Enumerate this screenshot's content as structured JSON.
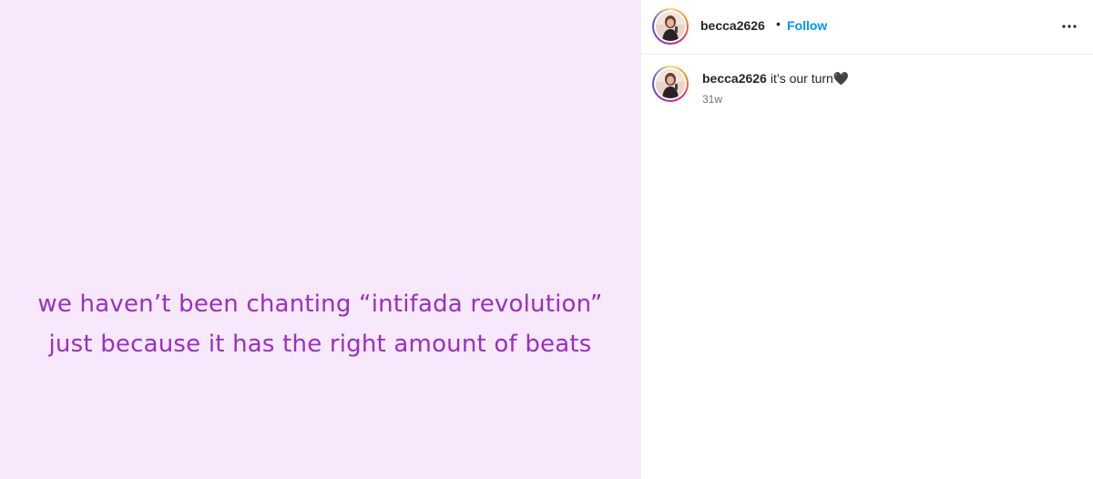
{
  "post": {
    "media_text_lines": [
      "we haven’t been chanting “intifada revolution”",
      "just because it has the right amount of beats"
    ],
    "media_background": "#f7e8fb",
    "media_text_color": "#9a2fc0"
  },
  "header": {
    "username": "becca2626",
    "separator": "•",
    "follow_label": "Follow",
    "more_icon": "more-horizontal-icon"
  },
  "caption": {
    "username": "becca2626",
    "text": "it’s our turn🖤",
    "timestamp": "31w"
  },
  "colors": {
    "follow_blue": "#0095f6",
    "text_dark": "#262626",
    "text_muted": "#737373"
  }
}
